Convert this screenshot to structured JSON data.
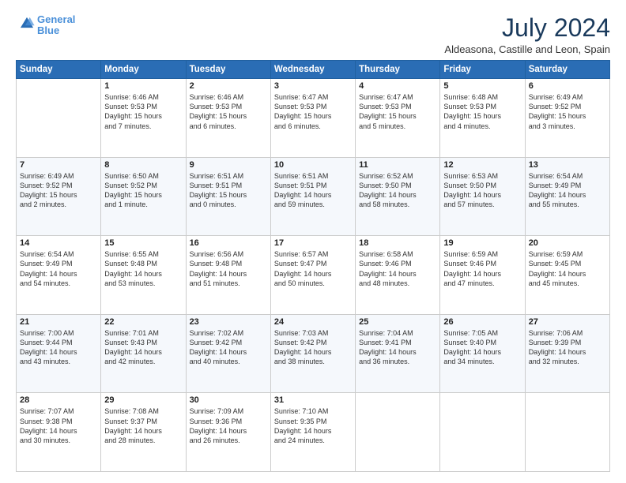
{
  "logo": {
    "line1": "General",
    "line2": "Blue"
  },
  "title": "July 2024",
  "subtitle": "Aldeasona, Castille and Leon, Spain",
  "weekdays": [
    "Sunday",
    "Monday",
    "Tuesday",
    "Wednesday",
    "Thursday",
    "Friday",
    "Saturday"
  ],
  "weeks": [
    [
      {
        "day": "",
        "info": ""
      },
      {
        "day": "1",
        "info": "Sunrise: 6:46 AM\nSunset: 9:53 PM\nDaylight: 15 hours\nand 7 minutes."
      },
      {
        "day": "2",
        "info": "Sunrise: 6:46 AM\nSunset: 9:53 PM\nDaylight: 15 hours\nand 6 minutes."
      },
      {
        "day": "3",
        "info": "Sunrise: 6:47 AM\nSunset: 9:53 PM\nDaylight: 15 hours\nand 6 minutes."
      },
      {
        "day": "4",
        "info": "Sunrise: 6:47 AM\nSunset: 9:53 PM\nDaylight: 15 hours\nand 5 minutes."
      },
      {
        "day": "5",
        "info": "Sunrise: 6:48 AM\nSunset: 9:53 PM\nDaylight: 15 hours\nand 4 minutes."
      },
      {
        "day": "6",
        "info": "Sunrise: 6:49 AM\nSunset: 9:52 PM\nDaylight: 15 hours\nand 3 minutes."
      }
    ],
    [
      {
        "day": "7",
        "info": "Sunrise: 6:49 AM\nSunset: 9:52 PM\nDaylight: 15 hours\nand 2 minutes."
      },
      {
        "day": "8",
        "info": "Sunrise: 6:50 AM\nSunset: 9:52 PM\nDaylight: 15 hours\nand 1 minute."
      },
      {
        "day": "9",
        "info": "Sunrise: 6:51 AM\nSunset: 9:51 PM\nDaylight: 15 hours\nand 0 minutes."
      },
      {
        "day": "10",
        "info": "Sunrise: 6:51 AM\nSunset: 9:51 PM\nDaylight: 14 hours\nand 59 minutes."
      },
      {
        "day": "11",
        "info": "Sunrise: 6:52 AM\nSunset: 9:50 PM\nDaylight: 14 hours\nand 58 minutes."
      },
      {
        "day": "12",
        "info": "Sunrise: 6:53 AM\nSunset: 9:50 PM\nDaylight: 14 hours\nand 57 minutes."
      },
      {
        "day": "13",
        "info": "Sunrise: 6:54 AM\nSunset: 9:49 PM\nDaylight: 14 hours\nand 55 minutes."
      }
    ],
    [
      {
        "day": "14",
        "info": "Sunrise: 6:54 AM\nSunset: 9:49 PM\nDaylight: 14 hours\nand 54 minutes."
      },
      {
        "day": "15",
        "info": "Sunrise: 6:55 AM\nSunset: 9:48 PM\nDaylight: 14 hours\nand 53 minutes."
      },
      {
        "day": "16",
        "info": "Sunrise: 6:56 AM\nSunset: 9:48 PM\nDaylight: 14 hours\nand 51 minutes."
      },
      {
        "day": "17",
        "info": "Sunrise: 6:57 AM\nSunset: 9:47 PM\nDaylight: 14 hours\nand 50 minutes."
      },
      {
        "day": "18",
        "info": "Sunrise: 6:58 AM\nSunset: 9:46 PM\nDaylight: 14 hours\nand 48 minutes."
      },
      {
        "day": "19",
        "info": "Sunrise: 6:59 AM\nSunset: 9:46 PM\nDaylight: 14 hours\nand 47 minutes."
      },
      {
        "day": "20",
        "info": "Sunrise: 6:59 AM\nSunset: 9:45 PM\nDaylight: 14 hours\nand 45 minutes."
      }
    ],
    [
      {
        "day": "21",
        "info": "Sunrise: 7:00 AM\nSunset: 9:44 PM\nDaylight: 14 hours\nand 43 minutes."
      },
      {
        "day": "22",
        "info": "Sunrise: 7:01 AM\nSunset: 9:43 PM\nDaylight: 14 hours\nand 42 minutes."
      },
      {
        "day": "23",
        "info": "Sunrise: 7:02 AM\nSunset: 9:42 PM\nDaylight: 14 hours\nand 40 minutes."
      },
      {
        "day": "24",
        "info": "Sunrise: 7:03 AM\nSunset: 9:42 PM\nDaylight: 14 hours\nand 38 minutes."
      },
      {
        "day": "25",
        "info": "Sunrise: 7:04 AM\nSunset: 9:41 PM\nDaylight: 14 hours\nand 36 minutes."
      },
      {
        "day": "26",
        "info": "Sunrise: 7:05 AM\nSunset: 9:40 PM\nDaylight: 14 hours\nand 34 minutes."
      },
      {
        "day": "27",
        "info": "Sunrise: 7:06 AM\nSunset: 9:39 PM\nDaylight: 14 hours\nand 32 minutes."
      }
    ],
    [
      {
        "day": "28",
        "info": "Sunrise: 7:07 AM\nSunset: 9:38 PM\nDaylight: 14 hours\nand 30 minutes."
      },
      {
        "day": "29",
        "info": "Sunrise: 7:08 AM\nSunset: 9:37 PM\nDaylight: 14 hours\nand 28 minutes."
      },
      {
        "day": "30",
        "info": "Sunrise: 7:09 AM\nSunset: 9:36 PM\nDaylight: 14 hours\nand 26 minutes."
      },
      {
        "day": "31",
        "info": "Sunrise: 7:10 AM\nSunset: 9:35 PM\nDaylight: 14 hours\nand 24 minutes."
      },
      {
        "day": "",
        "info": ""
      },
      {
        "day": "",
        "info": ""
      },
      {
        "day": "",
        "info": ""
      }
    ]
  ]
}
